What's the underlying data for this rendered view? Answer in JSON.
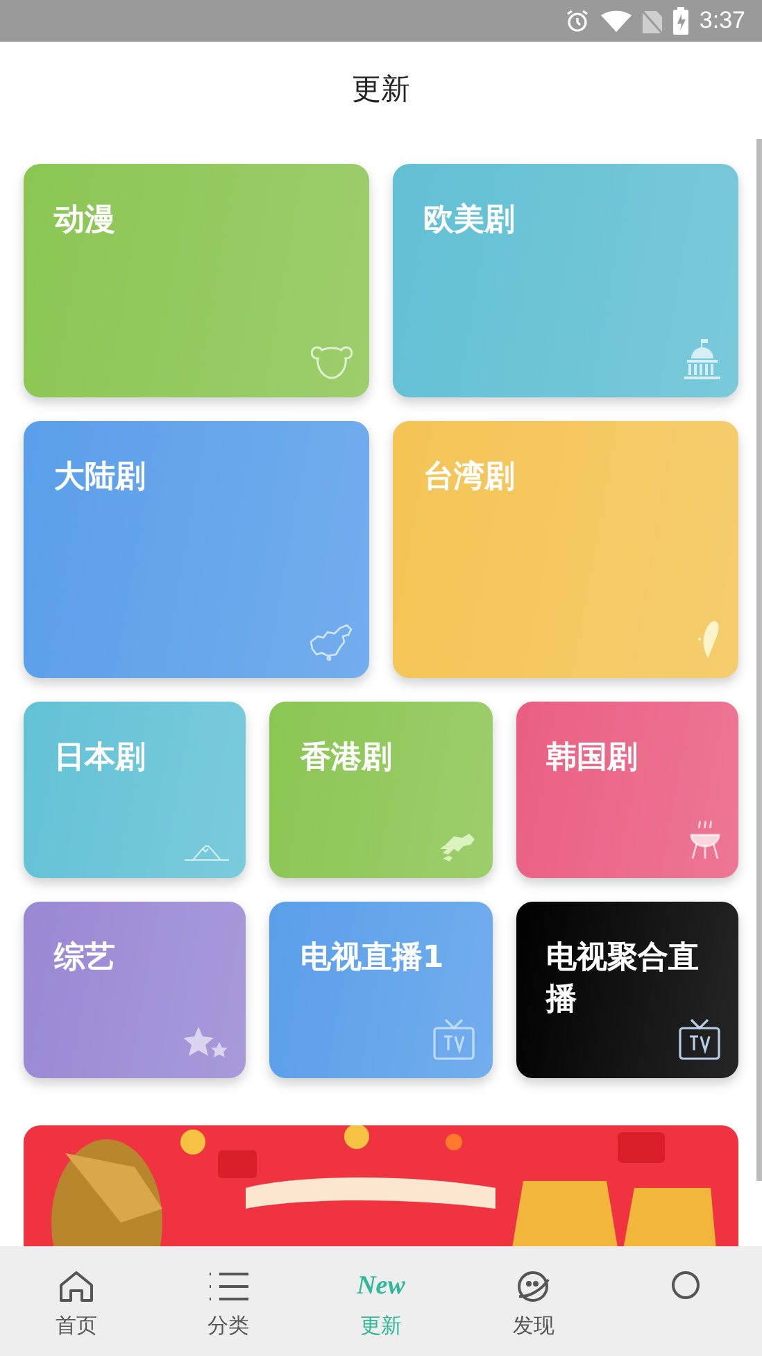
{
  "status_bar": {
    "time": "3:37"
  },
  "header": {
    "title": "更新"
  },
  "card_rows": [
    {
      "cards": [
        {
          "title": "动漫",
          "color": "#8bc653",
          "kind": "bear"
        },
        {
          "title": "欧美剧",
          "color": "#62c0d4",
          "kind": "capitol"
        }
      ]
    },
    {
      "cards": [
        {
          "title": "大陆剧",
          "color": "#5a9fea",
          "kind": "map"
        },
        {
          "title": "台湾剧",
          "color": "#f4c454",
          "kind": "island"
        }
      ]
    },
    {
      "cards": [
        {
          "title": "日本剧",
          "color": "#63c2d6",
          "kind": "mountain"
        },
        {
          "title": "香港剧",
          "color": "#8bc653",
          "kind": "coast"
        },
        {
          "title": "韩国剧",
          "color": "#ea5f82",
          "kind": "grill"
        }
      ]
    },
    {
      "cards": [
        {
          "title": "综艺",
          "color": "#9a88d4",
          "kind": "stars"
        },
        {
          "title": "电视直播1",
          "color": "#5a9fea",
          "kind": "tv"
        },
        {
          "title": "电视聚合直播",
          "color": "#000000",
          "kind": "tv"
        }
      ]
    }
  ],
  "nav": [
    {
      "label": "首页",
      "kind": "home",
      "selected": false
    },
    {
      "label": "分类",
      "kind": "list",
      "selected": false
    },
    {
      "label": "更新",
      "kind": "new",
      "icon_text": "New",
      "selected": true
    },
    {
      "label": "发现",
      "kind": "planet",
      "selected": false
    },
    {
      "kind": "person",
      "selected": false
    }
  ]
}
